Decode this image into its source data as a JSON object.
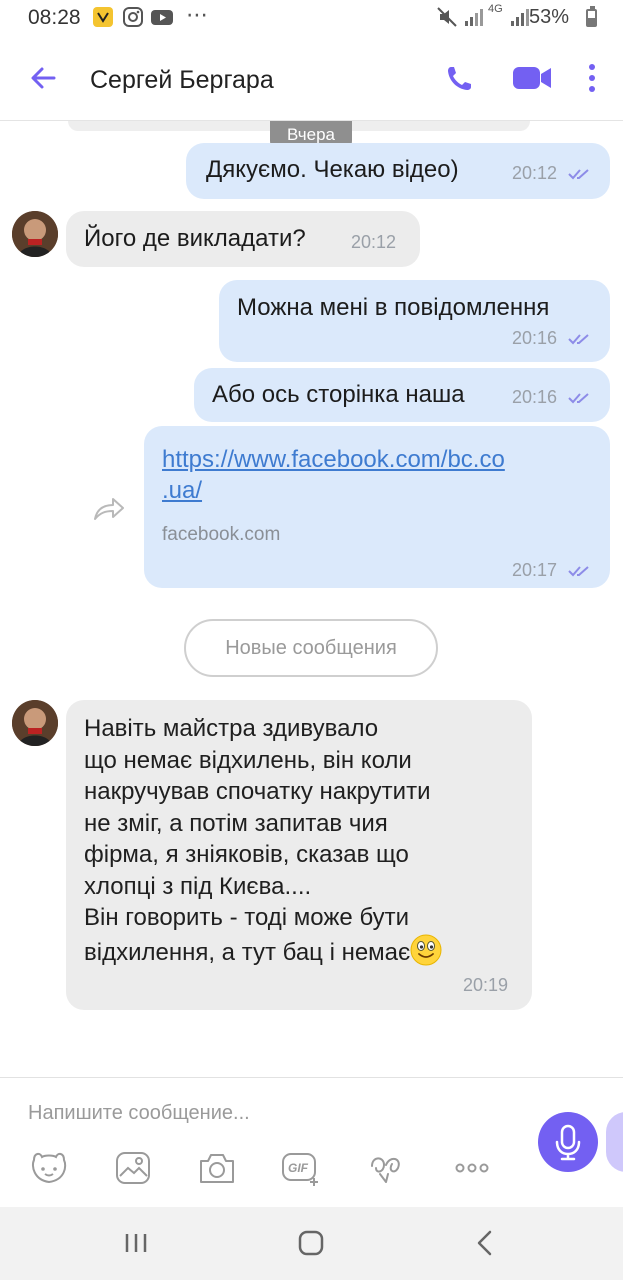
{
  "status_bar": {
    "time": "08:28",
    "battery": "53%",
    "network": "4G"
  },
  "header": {
    "contact_name": "Сергей Бергара"
  },
  "chat": {
    "date_divider": "Вчера",
    "messages": [
      {
        "direction": "outgoing",
        "text": "Дякуємо. Чекаю відео)",
        "time": "20:12"
      },
      {
        "direction": "incoming",
        "text": "Його де викладати?",
        "time": "20:12"
      },
      {
        "direction": "outgoing",
        "text": "Можна мені в повідомлення",
        "time": "20:16"
      },
      {
        "direction": "outgoing",
        "text": "Або ось сторінка наша",
        "time": "20:16"
      },
      {
        "direction": "outgoing",
        "link_line1": "https://www.facebook.com/bc.co",
        "link_line2": ".ua/",
        "link_domain": "facebook.com",
        "time": "20:17"
      }
    ],
    "new_messages_label": "Новые сообщения",
    "last_message": {
      "direction": "incoming",
      "text": "Навіть майстра здивувало\nщо немає відхилень, він коли\nнакручував спочатку накрутити\nне зміг, а потім запитав чия\nфірма, я зніяковів, сказав що\nхлопці з під Києва....\nВін говорить - тоді може бути\nвідхилення, а тут бац і немає",
      "time": "20:19"
    }
  },
  "composer": {
    "placeholder": "Напишите сообщение...",
    "gif_label": "GIF"
  },
  "colors": {
    "accent": "#7360f2",
    "outgoing_bubble": "#dbe9fb",
    "incoming_bubble": "#ececec",
    "link": "#3e7bd0"
  },
  "icons": [
    "back-arrow-icon",
    "phone-icon",
    "video-call-icon",
    "more-vertical-icon",
    "share-icon",
    "sticker-icon",
    "gallery-icon",
    "camera-icon",
    "gif-icon",
    "doodle-icon",
    "more-horizontal-icon",
    "microphone-icon"
  ]
}
